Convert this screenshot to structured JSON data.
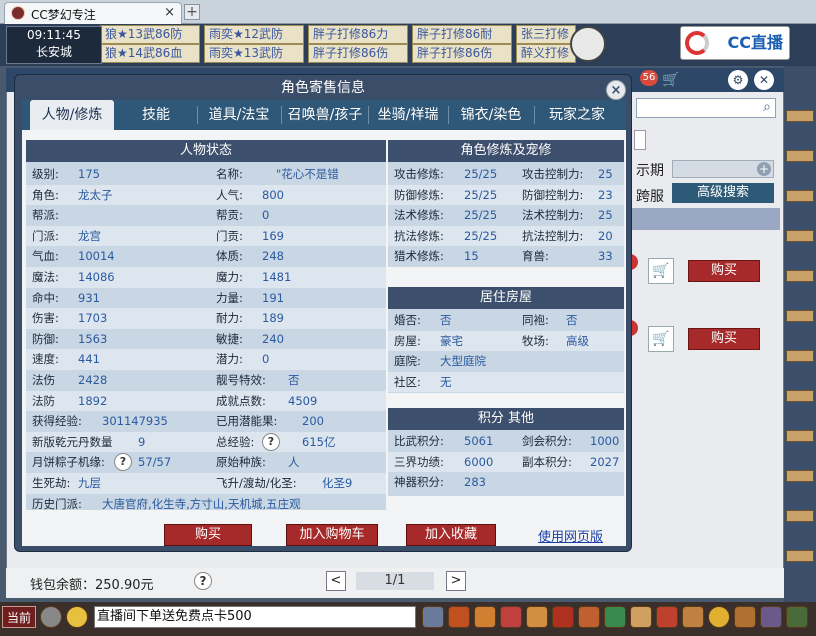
{
  "browser": {
    "tab_title": "CC梦幻专注",
    "tab_close": "×",
    "new_tab": "+"
  },
  "game_top": {
    "clock_time": "09:11:45",
    "location": "长安城",
    "banners_row1": [
      "狼★13武86防",
      "雨奕★12武防",
      "胖子打修86力",
      "胖子打修86耐",
      "张三打修"
    ],
    "banners_row2": [
      "狼★14武86血",
      "雨奕★13武防",
      "胖子打修86伤",
      "胖子打修86伤",
      "醉义打修"
    ],
    "cc_badge": "CC直播"
  },
  "bg_window": {
    "badge_count": "56",
    "time_label": "示期",
    "cross_label": "跨服",
    "advanced_search": "高级搜索",
    "buy_label": "购买",
    "balance_label": "钱包余额：",
    "balance_value": "250.90元",
    "help_mark": "?",
    "page_indicator": "1/1",
    "prev": "<",
    "next": ">"
  },
  "dialog": {
    "title": "角色寄售信息",
    "close": "×",
    "tabs": [
      "人物/修炼",
      "技能",
      "道具/法宝",
      "召唤兽/孩子",
      "坐骑/祥瑞",
      "锦衣/染色",
      "玩家之家"
    ],
    "active_tab": 0,
    "status_panel": {
      "header": "人物状态",
      "rows": [
        {
          "l1": "级别:",
          "v1": "175",
          "l2": "名称:",
          "v2": "\"花心不是错"
        },
        {
          "l1": "角色:",
          "v1": "龙太子",
          "l2": "人气:",
          "v2": "800"
        },
        {
          "l1": "帮派:",
          "v1": "",
          "l2": "帮贡:",
          "v2": "0"
        },
        {
          "l1": "门派:",
          "v1": "龙宫",
          "l2": "门贡:",
          "v2": "169"
        },
        {
          "l1": "气血:",
          "v1": "10014",
          "l2": "体质:",
          "v2": "248"
        },
        {
          "l1": "魔法:",
          "v1": "14086",
          "l2": "魔力:",
          "v2": "1481"
        },
        {
          "l1": "命中:",
          "v1": "931",
          "l2": "力量:",
          "v2": "191"
        },
        {
          "l1": "伤害:",
          "v1": "1703",
          "l2": "耐力:",
          "v2": "189"
        },
        {
          "l1": "防御:",
          "v1": "1563",
          "l2": "敏捷:",
          "v2": "240"
        },
        {
          "l1": "速度:",
          "v1": "441",
          "l2": "潜力:",
          "v2": "0"
        },
        {
          "l1": "法伤",
          "v1": "2428",
          "l2": "靓号特效:",
          "v2": "否"
        },
        {
          "l1": "法防",
          "v1": "1892",
          "l2": "成就点数:",
          "v2": "4509"
        },
        {
          "l1": "获得经验:",
          "v1": "301147935",
          "l2": "已用潜能果:",
          "v2": "200"
        },
        {
          "l1": "新版乾元丹数量",
          "v1": "9",
          "l2": "总经验:",
          "v2": "615亿"
        },
        {
          "l1": "月饼粽子机缘:",
          "v1": "57/57",
          "l2": "原始种族:",
          "v2": "人"
        },
        {
          "l1": "生死劫:",
          "v1": "九层",
          "l2": "飞升/渡劫/化圣:",
          "v2": "化圣9"
        },
        {
          "l1": "历史门派:",
          "v1": "大唐官府,化生寺,方寸山,天机城,五庄观",
          "l2": "",
          "v2": ""
        }
      ]
    },
    "cultivation_panel": {
      "header": "角色修炼及宠修",
      "rows": [
        {
          "l1": "攻击修炼:",
          "v1": "25/25",
          "l2": "攻击控制力:",
          "v2": "25"
        },
        {
          "l1": "防御修炼:",
          "v1": "25/25",
          "l2": "防御控制力:",
          "v2": "23"
        },
        {
          "l1": "法术修炼:",
          "v1": "25/25",
          "l2": "法术控制力:",
          "v2": "25"
        },
        {
          "l1": "抗法修炼:",
          "v1": "25/25",
          "l2": "抗法控制力:",
          "v2": "20"
        },
        {
          "l1": "猎术修炼:",
          "v1": "15",
          "l2": "育兽:",
          "v2": "33"
        }
      ]
    },
    "house_panel": {
      "header": "居住房屋",
      "rows": [
        {
          "l1": "婚否:",
          "v1": "否",
          "l2": "同袍:",
          "v2": "否"
        },
        {
          "l1": "房屋:",
          "v1": "豪宅",
          "l2": "牧场:",
          "v2": "高级"
        },
        {
          "l1": "庭院:",
          "v1": "大型庭院",
          "l2": "",
          "v2": ""
        },
        {
          "l1": "社区:",
          "v1": "无",
          "l2": "",
          "v2": ""
        }
      ]
    },
    "points_panel": {
      "header": "积分 其他",
      "rows": [
        {
          "l1": "比武积分:",
          "v1": "5061",
          "l2": "剑会积分:",
          "v2": "1000"
        },
        {
          "l1": "三界功绩:",
          "v1": "6000",
          "l2": "副本积分:",
          "v2": "2027"
        },
        {
          "l1": "神器积分:",
          "v1": "283",
          "l2": "",
          "v2": ""
        }
      ]
    },
    "buttons": {
      "buy": "购买",
      "add_cart": "加入购物车",
      "add_fav": "加入收藏",
      "web": "使用网页版"
    }
  },
  "bottom_bar": {
    "current": "当前",
    "chat_text": "直播间下单送免费点卡500"
  },
  "colors": {
    "dialog_bg": "#3a4e6a",
    "panel_header": "#3c4f6c",
    "value_text": "#2a5aa0",
    "button_red": "#a62a2a"
  }
}
